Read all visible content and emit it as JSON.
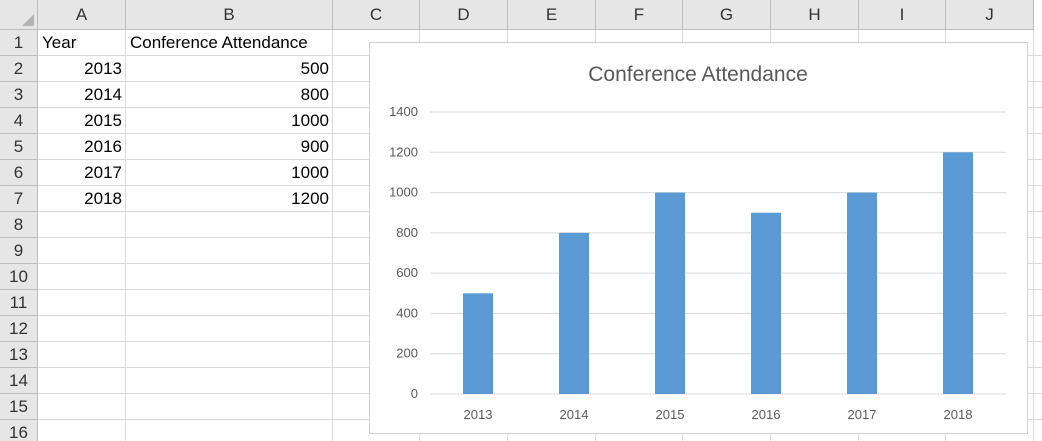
{
  "columns": [
    "A",
    "B",
    "C",
    "D",
    "E",
    "F",
    "G",
    "H",
    "I",
    "J"
  ],
  "rows": [
    "1",
    "2",
    "3",
    "4",
    "5",
    "6",
    "7",
    "8",
    "9",
    "10",
    "11",
    "12",
    "13",
    "14",
    "15",
    "16"
  ],
  "cells": {
    "A1": "Year",
    "B1": "Conference Attendance",
    "A2": "2013",
    "B2": "500",
    "A3": "2014",
    "B3": "800",
    "A4": "2015",
    "B4": "1000",
    "A5": "2016",
    "B5": "900",
    "A6": "2017",
    "B6": "1000",
    "A7": "2018",
    "B7": "1200"
  },
  "chart_data": {
    "type": "bar",
    "title": "Conference Attendance",
    "categories": [
      "2013",
      "2014",
      "2015",
      "2016",
      "2017",
      "2018"
    ],
    "values": [
      500,
      800,
      1000,
      900,
      1000,
      1200
    ],
    "ylim": [
      0,
      1400
    ],
    "yticks": [
      0,
      200,
      400,
      600,
      800,
      1000,
      1200,
      1400
    ],
    "xlabel": "",
    "ylabel": "",
    "grid": true,
    "legend": "none",
    "colors": {
      "bar": "#5b9bd5",
      "grid": "#d9d9d9",
      "text": "#595959"
    }
  }
}
